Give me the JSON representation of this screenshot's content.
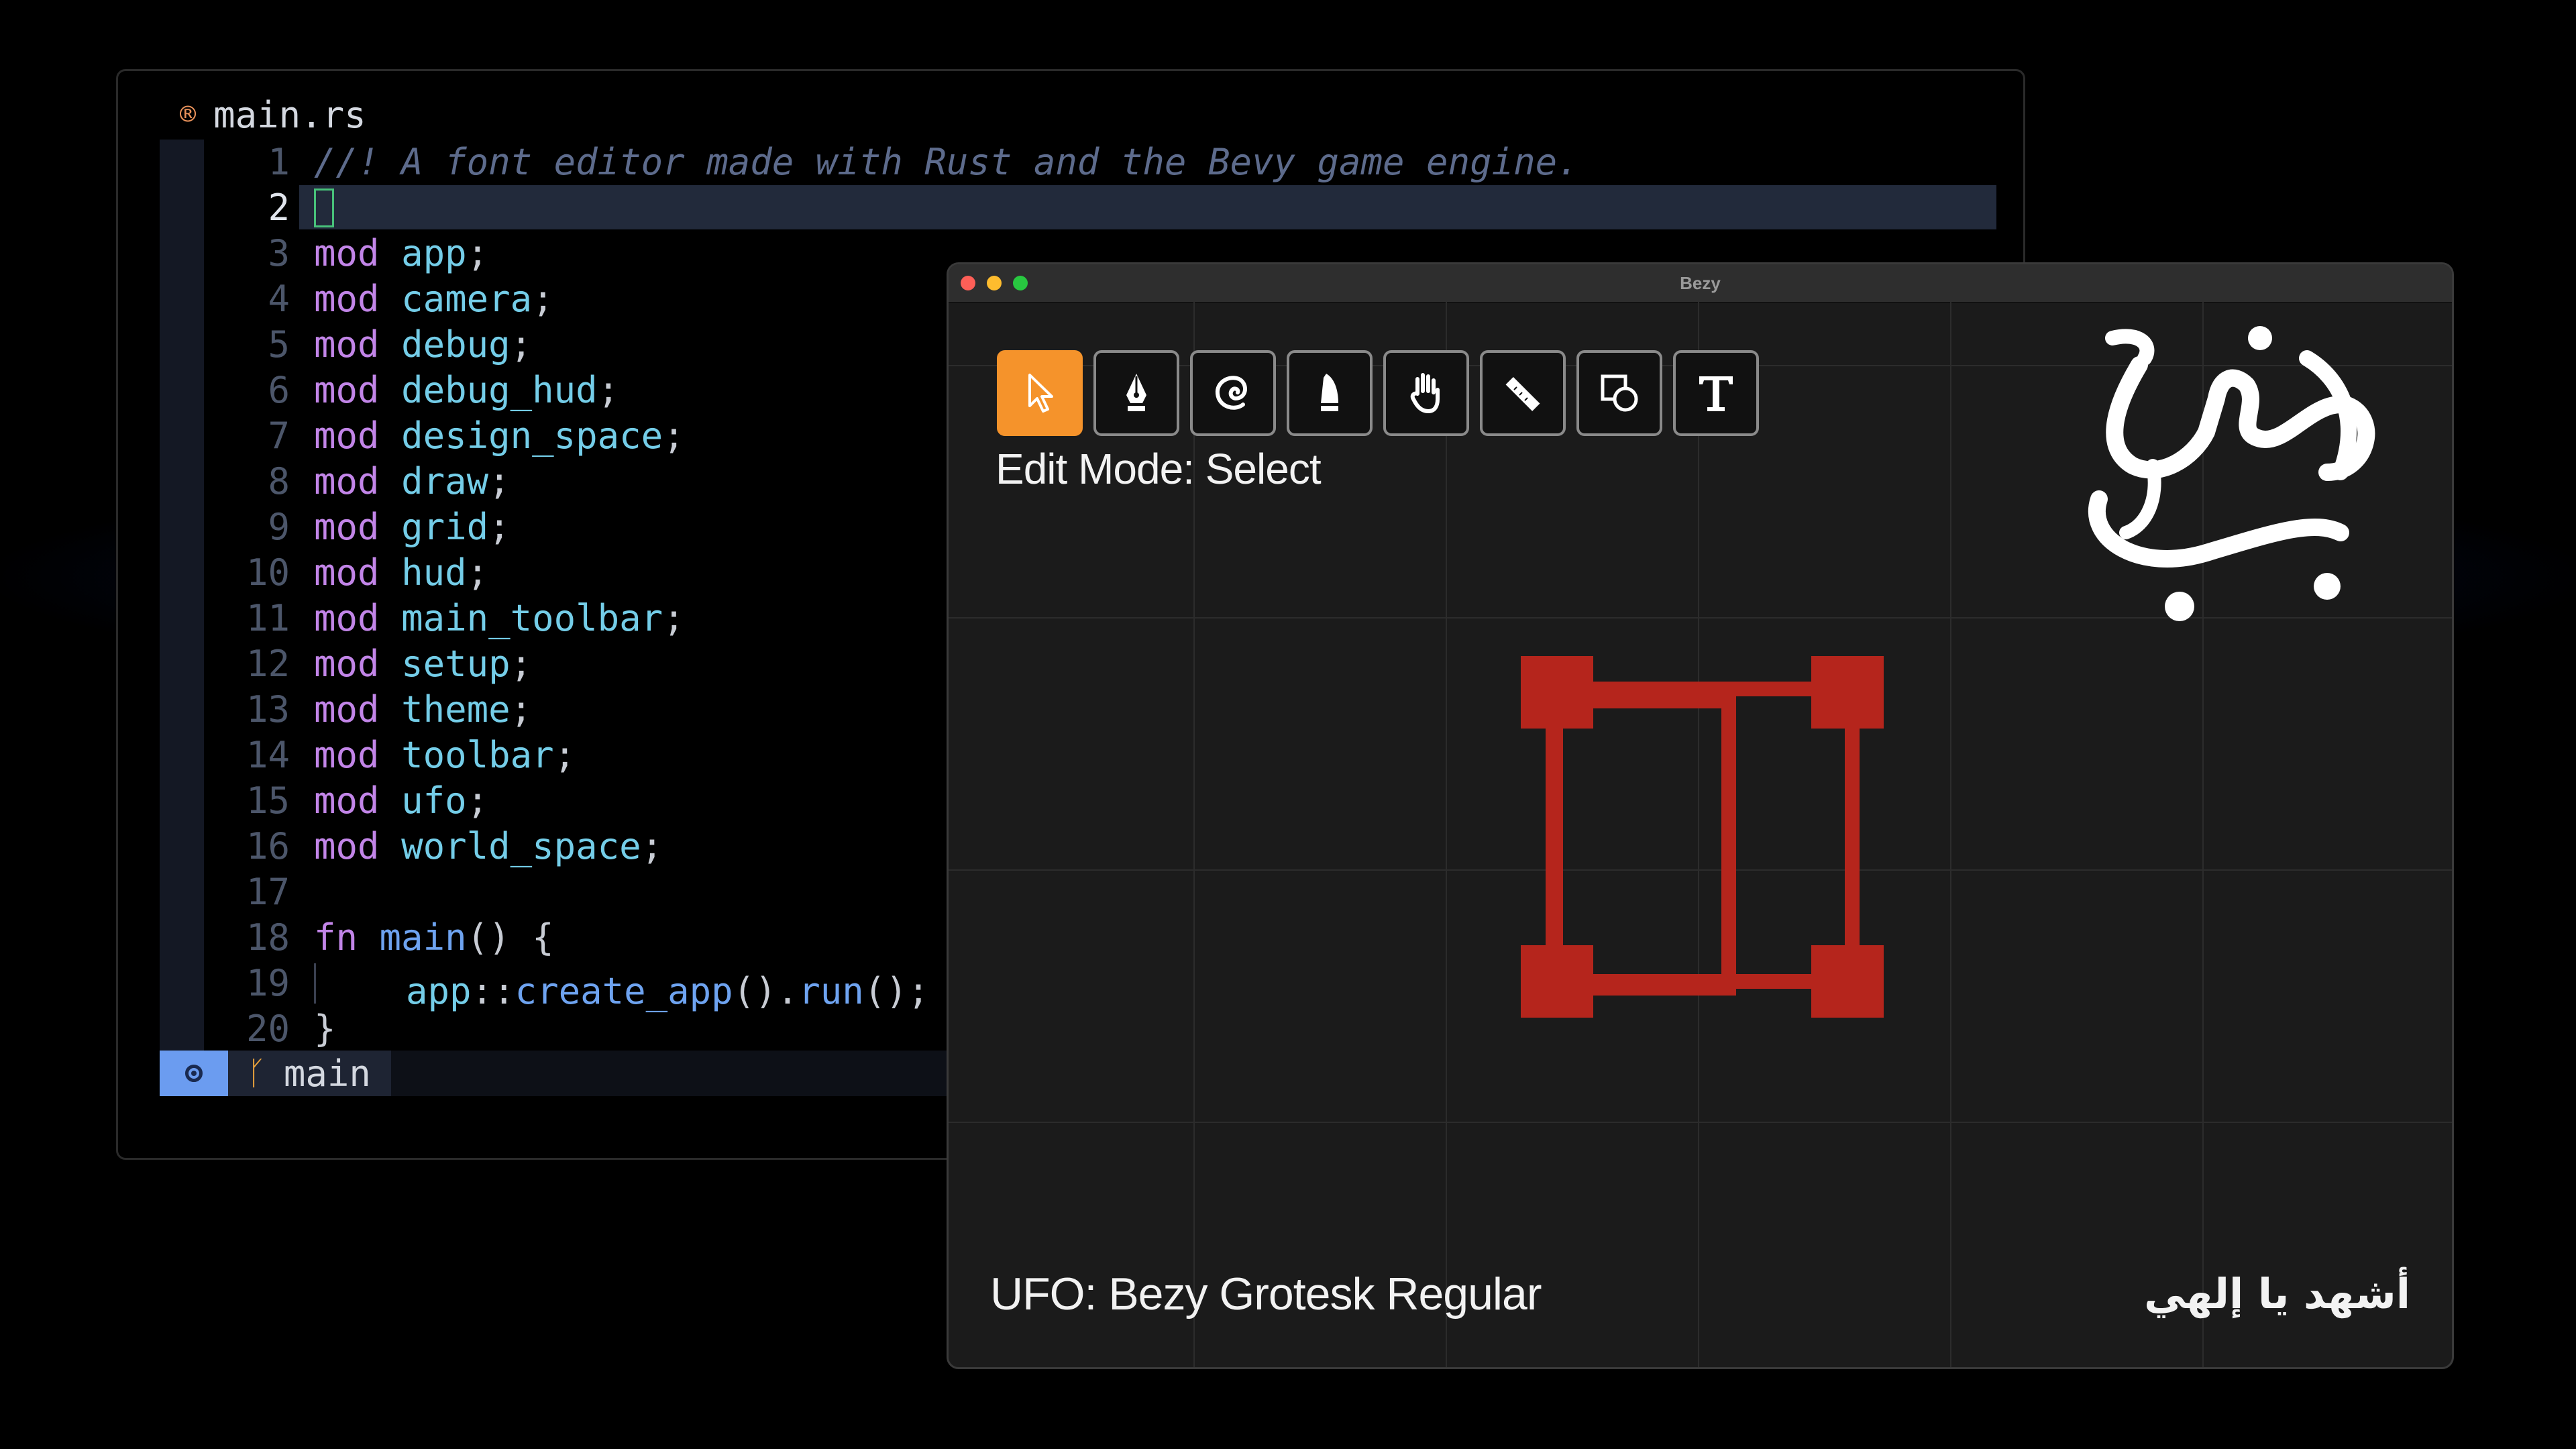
{
  "editor": {
    "tab_title": "main.rs",
    "lines": [
      {
        "n": "1",
        "tokens": [
          [
            "cm",
            "//! A font editor made with Rust and the Bevy game engine."
          ]
        ]
      },
      {
        "n": "2",
        "tokens": [],
        "cursor": true
      },
      {
        "n": "3",
        "tokens": [
          [
            "kw",
            "mod"
          ],
          [
            "pn",
            " "
          ],
          [
            "id",
            "app"
          ],
          [
            "pn",
            ";"
          ]
        ]
      },
      {
        "n": "4",
        "tokens": [
          [
            "kw",
            "mod"
          ],
          [
            "pn",
            " "
          ],
          [
            "id",
            "camera"
          ],
          [
            "pn",
            ";"
          ]
        ]
      },
      {
        "n": "5",
        "tokens": [
          [
            "kw",
            "mod"
          ],
          [
            "pn",
            " "
          ],
          [
            "id",
            "debug"
          ],
          [
            "pn",
            ";"
          ]
        ]
      },
      {
        "n": "6",
        "tokens": [
          [
            "kw",
            "mod"
          ],
          [
            "pn",
            " "
          ],
          [
            "id",
            "debug_hud"
          ],
          [
            "pn",
            ";"
          ]
        ]
      },
      {
        "n": "7",
        "tokens": [
          [
            "kw",
            "mod"
          ],
          [
            "pn",
            " "
          ],
          [
            "id",
            "design_space"
          ],
          [
            "pn",
            ";"
          ]
        ]
      },
      {
        "n": "8",
        "tokens": [
          [
            "kw",
            "mod"
          ],
          [
            "pn",
            " "
          ],
          [
            "id",
            "draw"
          ],
          [
            "pn",
            ";"
          ]
        ]
      },
      {
        "n": "9",
        "tokens": [
          [
            "kw",
            "mod"
          ],
          [
            "pn",
            " "
          ],
          [
            "id",
            "grid"
          ],
          [
            "pn",
            ";"
          ]
        ]
      },
      {
        "n": "10",
        "tokens": [
          [
            "kw",
            "mod"
          ],
          [
            "pn",
            " "
          ],
          [
            "id",
            "hud"
          ],
          [
            "pn",
            ";"
          ]
        ]
      },
      {
        "n": "11",
        "tokens": [
          [
            "kw",
            "mod"
          ],
          [
            "pn",
            " "
          ],
          [
            "id",
            "main_toolbar"
          ],
          [
            "pn",
            ";"
          ]
        ]
      },
      {
        "n": "12",
        "tokens": [
          [
            "kw",
            "mod"
          ],
          [
            "pn",
            " "
          ],
          [
            "id",
            "setup"
          ],
          [
            "pn",
            ";"
          ]
        ]
      },
      {
        "n": "13",
        "tokens": [
          [
            "kw",
            "mod"
          ],
          [
            "pn",
            " "
          ],
          [
            "id",
            "theme"
          ],
          [
            "pn",
            ";"
          ]
        ]
      },
      {
        "n": "14",
        "tokens": [
          [
            "kw",
            "mod"
          ],
          [
            "pn",
            " "
          ],
          [
            "id",
            "toolbar"
          ],
          [
            "pn",
            ";"
          ]
        ]
      },
      {
        "n": "15",
        "tokens": [
          [
            "kw",
            "mod"
          ],
          [
            "pn",
            " "
          ],
          [
            "id",
            "ufo"
          ],
          [
            "pn",
            ";"
          ]
        ]
      },
      {
        "n": "16",
        "tokens": [
          [
            "kw",
            "mod"
          ],
          [
            "pn",
            " "
          ],
          [
            "id",
            "world_space"
          ],
          [
            "pn",
            ";"
          ]
        ]
      },
      {
        "n": "17",
        "tokens": []
      },
      {
        "n": "18",
        "tokens": [
          [
            "kw",
            "fn"
          ],
          [
            "pn",
            " "
          ],
          [
            "fn",
            "main"
          ],
          [
            "pn",
            "() {"
          ]
        ]
      },
      {
        "n": "19",
        "tokens": [
          [
            "id",
            "app"
          ],
          [
            "pn",
            "::"
          ],
          [
            "fn",
            "create_app"
          ],
          [
            "pn",
            "()."
          ],
          [
            "fn",
            "run"
          ],
          [
            "pn",
            "();"
          ]
        ],
        "indent": true
      },
      {
        "n": "20",
        "tokens": [
          [
            "pn",
            "}"
          ]
        ]
      }
    ],
    "active_line": "2",
    "status": {
      "branch": "main"
    }
  },
  "bezy": {
    "window_title": "Bezy",
    "tools": [
      {
        "name": "select",
        "active": true
      },
      {
        "name": "pen",
        "active": false
      },
      {
        "name": "hyper",
        "active": false
      },
      {
        "name": "knife",
        "active": false
      },
      {
        "name": "pan",
        "active": false
      },
      {
        "name": "measure",
        "active": false
      },
      {
        "name": "shapes",
        "active": false
      },
      {
        "name": "text",
        "active": false
      }
    ],
    "edit_mode": "Edit Mode: Select",
    "ufo": "UFO: Bezy Grotesk Regular",
    "arabic_text": "أشهد يا إلهي",
    "logo_text": "حرف باز",
    "colors": {
      "accent": "#f5932b",
      "glyph": "#b5251c"
    }
  }
}
